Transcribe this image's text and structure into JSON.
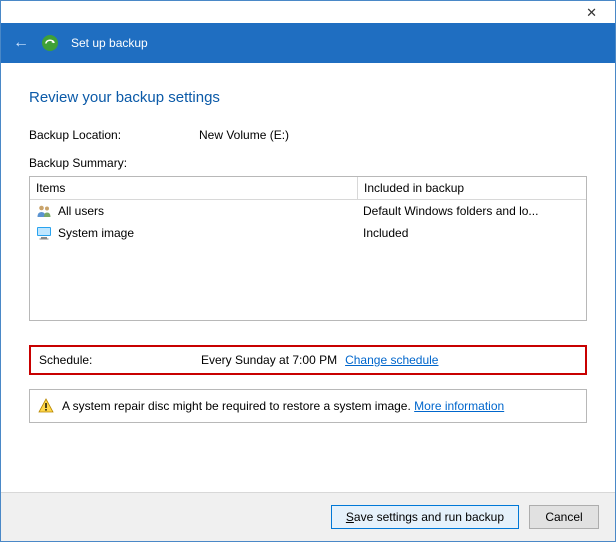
{
  "window": {
    "title": "Set up backup"
  },
  "page": {
    "heading": "Review your backup settings",
    "location_label": "Backup Location:",
    "location_value": "New Volume (E:)",
    "summary_label": "Backup Summary:",
    "columns": {
      "items": "Items",
      "included": "Included in backup"
    },
    "rows": [
      {
        "icon": "users-icon",
        "name": "All users",
        "included": "Default Windows folders and lo..."
      },
      {
        "icon": "monitor-icon",
        "name": "System image",
        "included": "Included"
      }
    ],
    "schedule_label": "Schedule:",
    "schedule_value": "Every Sunday at 7:00 PM",
    "change_schedule": "Change schedule",
    "repair_note": "A system repair disc might be required to restore a system image.",
    "more_info": "More information"
  },
  "buttons": {
    "save": "Save settings and run backup",
    "cancel": "Cancel"
  }
}
